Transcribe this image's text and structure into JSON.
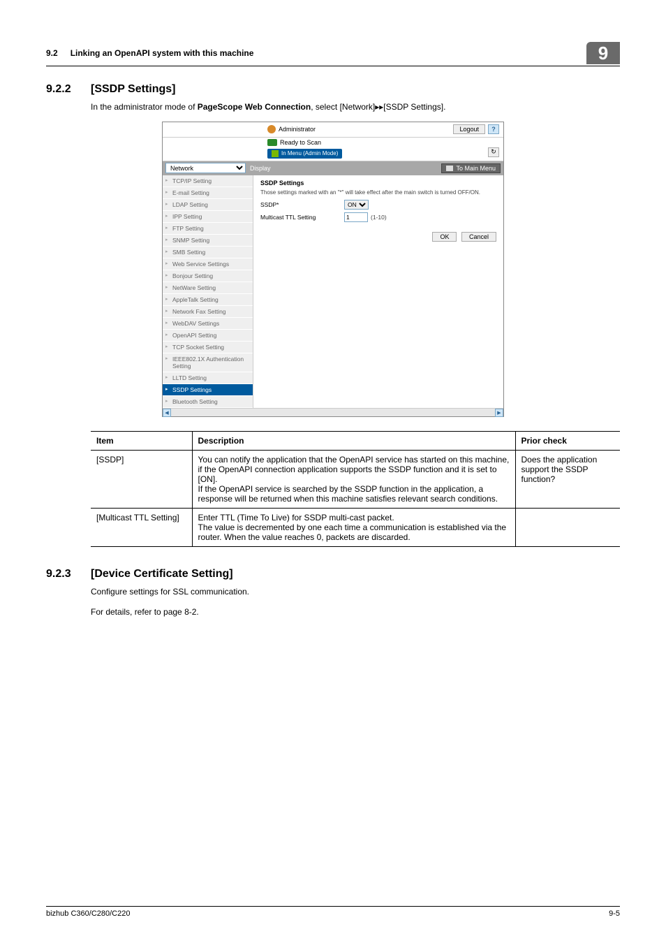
{
  "header": {
    "section": "9.2",
    "title": "Linking an OpenAPI system with this machine",
    "badge": "9"
  },
  "s1": {
    "num": "9.2.2",
    "title": "[SSDP Settings]",
    "intro_a": "In the administrator mode of ",
    "intro_b": "PageScope Web Connection",
    "intro_c": ", select [Network]▸▸[SSDP Settings]."
  },
  "shot": {
    "admin": "Administrator",
    "logout": "Logout",
    "help": "?",
    "ready": "Ready to Scan",
    "mbar": "In Menu (Admin Mode)",
    "reload": "↻",
    "select": "Network",
    "display": "Display",
    "mainmenu": "To Main Menu",
    "side": [
      "TCP/IP Setting",
      "E-mail Setting",
      "LDAP Setting",
      "IPP Setting",
      "FTP Setting",
      "SNMP Setting",
      "SMB Setting",
      "Web Service Settings",
      "Bonjour Setting",
      "NetWare Setting",
      "AppleTalk Setting",
      "Network Fax Setting",
      "WebDAV Settings",
      "OpenAPI Setting",
      "TCP Socket Setting",
      "IEEE802.1X Authentication Setting",
      "LLTD Setting",
      "SSDP Settings",
      "Bluetooth Setting"
    ],
    "side_active_index": 17,
    "panel_title": "SSDP Settings",
    "panel_note": "Those settings marked with an \"*\" will take effect after the main switch is turned OFF/ON.",
    "f_ssdp_label": "SSDP*",
    "f_ssdp_value": "ON",
    "f_ttl_label": "Multicast TTL Setting",
    "f_ttl_value": "1",
    "f_ttl_range": "(1-10)",
    "ok": "OK",
    "cancel": "Cancel"
  },
  "table": {
    "h1": "Item",
    "h2": "Description",
    "h3": "Prior check",
    "r1c1": "[SSDP]",
    "r1c2": "You can notify the application that the OpenAPI service has started on this machine, if the OpenAPI connection application supports the SSDP function and it is set to [ON].\nIf the OpenAPI service is searched by the SSDP function in the application, a response will be returned when this machine satisfies relevant search conditions.",
    "r1c3": "Does the application support the SSDP function?",
    "r2c1": "[Multicast TTL Setting]",
    "r2c2": "Enter TTL (Time To Live) for SSDP multi-cast packet.\nThe value is decremented by one each time a communication is established via the router. When the value reaches 0, packets are discarded.",
    "r2c3": ""
  },
  "s2": {
    "num": "9.2.3",
    "title": "[Device Certificate Setting]",
    "p1": "Configure settings for SSL communication.",
    "p2": "For details, refer to page 8-2."
  },
  "footer": {
    "left": "bizhub C360/C280/C220",
    "right": "9-5"
  }
}
